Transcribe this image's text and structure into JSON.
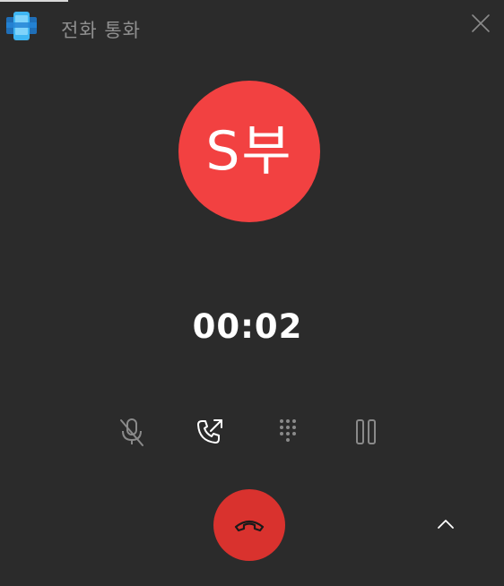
{
  "window": {
    "title": "전화 통화"
  },
  "caller": {
    "initials": "S부",
    "avatar_color": "#f24141"
  },
  "call": {
    "duration": "00:02"
  },
  "controls": [
    {
      "name": "mute-button",
      "icon": "microphone-off-icon",
      "state": "disabled"
    },
    {
      "name": "transfer-button",
      "icon": "phone-transfer-icon",
      "state": "enabled"
    },
    {
      "name": "keypad-button",
      "icon": "dialpad-icon",
      "state": "disabled"
    },
    {
      "name": "hold-button",
      "icon": "pause-icon",
      "state": "disabled"
    }
  ],
  "colors": {
    "background": "#2b2b2b",
    "hangup": "#d9322e",
    "enabled_icon": "#ffffff",
    "disabled_icon": "#8a8a8a"
  }
}
